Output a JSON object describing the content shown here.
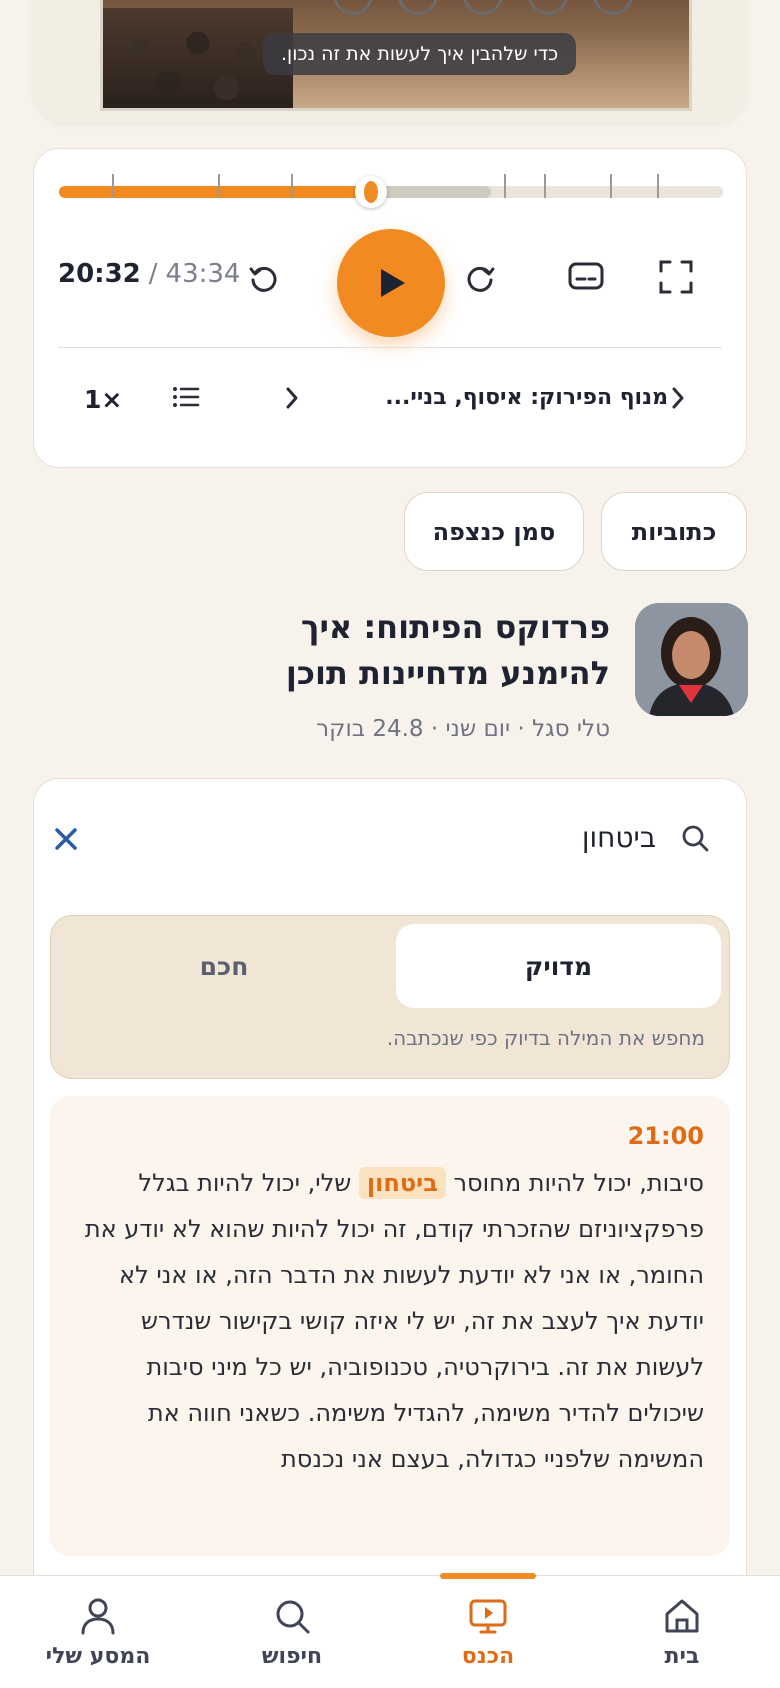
{
  "video": {
    "caption": "כדי שלהבין איך לעשות את זה נכון."
  },
  "player": {
    "progress_fraction": 0.47,
    "buffer_fraction": 0.65,
    "current_time": "20:32",
    "separator": "/",
    "total_time": "43:34",
    "chapter_title": "מנוף הפירוק: איסוף, בניי...",
    "speed": "1×",
    "chapter_ticks": [
      0.08,
      0.24,
      0.35,
      0.67,
      0.73,
      0.83,
      0.9
    ]
  },
  "actions": {
    "subtitles_label": "כתוביות",
    "bookmark_label": "סמן כנצפה"
  },
  "episode": {
    "title": "פרדוקס הפיתוח: איך להימנע מדחיינות תוכן",
    "meta": "טלי סגל · יום שני · 24.8 בוקר"
  },
  "search": {
    "query": "ביטחון",
    "mode_exact": "מדויק",
    "mode_smart": "חכם",
    "mode_description": "מחפש את המילה בדיוק כפי שנכתבה."
  },
  "result": {
    "time": "21:00",
    "text_before": "סיבות, יכול להיות מחוסר ",
    "highlight": "ביטחון",
    "text_after": " שלי, יכול להיות בגלל פרפקציוניזם שהזכרתי קודם, זה יכול להיות שהוא לא יודע את החומר, או אני לא יודעת לעשות את הדבר הזה, או אני לא יודעת איך לעצב את זה, יש לי איזה קושי בקישור שנדרש לעשות את זה. בירוקרטיה, טכנופוביה, יש כל מיני סיבות שיכולים להדיר משימה, להגדיל משימה. כשאני חווה את המשימה שלפניי כגדולה, בעצם אני נכנסת"
  },
  "nav": {
    "home": "בית",
    "lecture": "הכנס",
    "search": "חיפוש",
    "journey": "המסע שלי"
  },
  "colors": {
    "accent": "#f08a21",
    "accent_text": "#de6b15",
    "background": "#f7f3ec"
  }
}
